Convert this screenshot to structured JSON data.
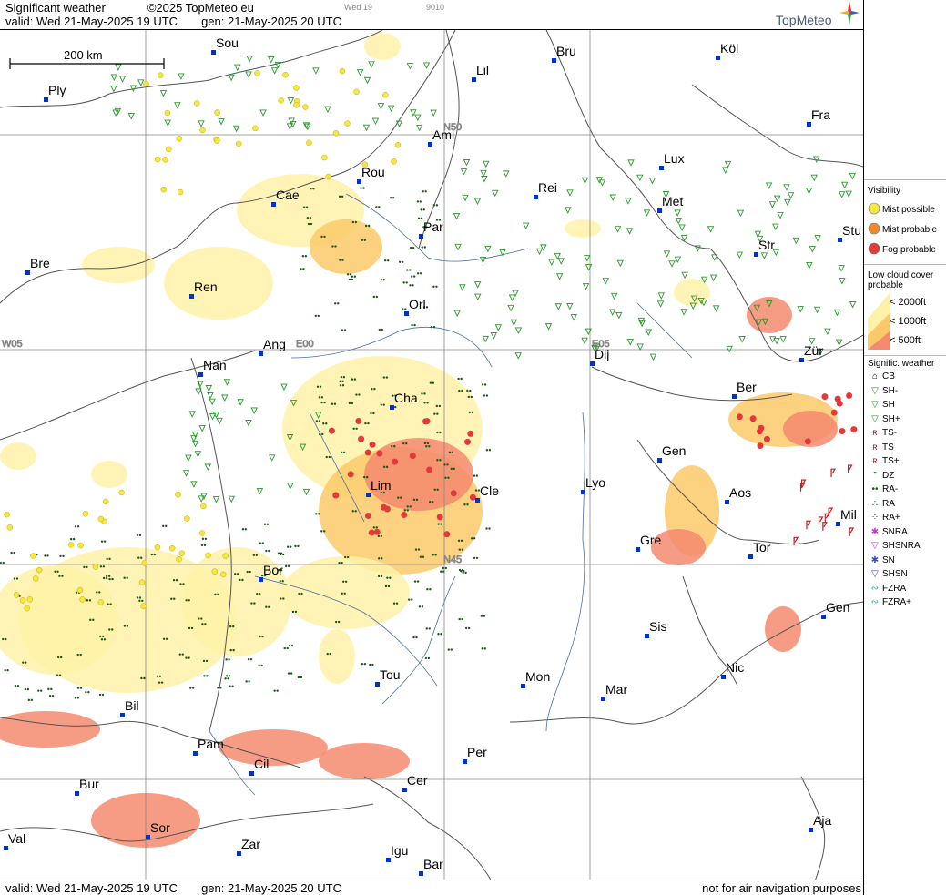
{
  "header": {
    "title": "Significant weather",
    "copyright": "©2025 TopMeteo.eu",
    "small_day": "Wed 19",
    "small_code": "9010",
    "valid": "valid:  Wed  21-May-2025  19 UTC",
    "gen": "gen: 21-May-2025 20 UTC",
    "brand": "TopMeteo"
  },
  "footer": {
    "valid": "valid:  Wed  21-May-2025  19 UTC",
    "gen": "gen: 21-May-2025 20 UTC",
    "note": "not for air navigation purposes"
  },
  "scale_bar": {
    "label": "200 km"
  },
  "grid_labels": [
    "N50",
    "N45",
    "W05",
    "E00",
    "E05"
  ],
  "cities": [
    "Sou",
    "Bru",
    "Köl",
    "Lil",
    "Ply",
    "Ami",
    "Fra",
    "Lux",
    "Rou",
    "Cae",
    "Rei",
    "Met",
    "Bre",
    "Par",
    "Stu",
    "Str",
    "Ren",
    "Orl",
    "Ang",
    "Nan",
    "Dij",
    "Zür",
    "Ber",
    "Cha",
    "Gen",
    "Lim",
    "Cle",
    "Lyo",
    "Aos",
    "Mil",
    "Gre",
    "Tor",
    "Bor",
    "Gen",
    "Sis",
    "Nic",
    "Tou",
    "Mon",
    "Mar",
    "Bil",
    "Pam",
    "Cil",
    "Per",
    "Bur",
    "Cer",
    "Sor",
    "Aja",
    "Val",
    "Zar",
    "Igu",
    "Bar"
  ],
  "legend": {
    "visibility_title": "Visibility",
    "visibility": [
      {
        "label": "Mist possible",
        "color": "#f5e642"
      },
      {
        "label": "Mist probable",
        "color": "#f08a2c"
      },
      {
        "label": "Fog probable",
        "color": "#e23a3a"
      }
    ],
    "cloud_title": [
      "Low cloud cover",
      "probable"
    ],
    "cloud": [
      {
        "label": "< 2000ft",
        "color": "#fff2a8"
      },
      {
        "label": "< 1000ft",
        "color": "#fcc96a"
      },
      {
        "label": "<  500ft",
        "color": "#f48a6e"
      }
    ],
    "weather_title": "Signific. weather",
    "weather": [
      {
        "label": "CB",
        "icon": "cb-icon",
        "glyph": "⌂",
        "color": "#000"
      },
      {
        "label": "SH-",
        "icon": "shower-light-icon",
        "glyph": "▽",
        "color": "#2a9a2a"
      },
      {
        "label": "SH",
        "icon": "shower-icon",
        "glyph": "▽",
        "color": "#2a9a2a"
      },
      {
        "label": "SH+",
        "icon": "shower-heavy-icon",
        "glyph": "▽",
        "color": "#2a9a2a"
      },
      {
        "label": "TS-",
        "icon": "thunderstorm-light-icon",
        "glyph": "ʀ",
        "color": "#b22"
      },
      {
        "label": "TS",
        "icon": "thunderstorm-icon",
        "glyph": "ʀ",
        "color": "#b22"
      },
      {
        "label": "TS+",
        "icon": "thunderstorm-heavy-icon",
        "glyph": "ʀ",
        "color": "#b22"
      },
      {
        "label": "DZ",
        "icon": "drizzle-icon",
        "glyph": "”",
        "color": "#1a5a1a"
      },
      {
        "label": "RA-",
        "icon": "rain-light-icon",
        "glyph": "••",
        "color": "#1a5a1a"
      },
      {
        "label": "RA",
        "icon": "rain-icon",
        "glyph": "∴",
        "color": "#1a5a1a"
      },
      {
        "label": "RA+",
        "icon": "rain-heavy-icon",
        "glyph": "⁘",
        "color": "#1a5a1a"
      },
      {
        "label": "SNRA",
        "icon": "snow-rain-icon",
        "glyph": "✱",
        "color": "#c040c0"
      },
      {
        "label": "SHSNRA",
        "icon": "shower-snow-rain-icon",
        "glyph": "▽",
        "color": "#c040c0"
      },
      {
        "label": "SN",
        "icon": "snow-icon",
        "glyph": "✱",
        "color": "#3050d0"
      },
      {
        "label": "SHSN",
        "icon": "shower-snow-icon",
        "glyph": "▽",
        "color": "#3050d0"
      },
      {
        "label": "FZRA",
        "icon": "freezing-rain-icon",
        "glyph": "∾",
        "color": "#1ab0d0"
      },
      {
        "label": "FZRA+",
        "icon": "freezing-rain-heavy-icon",
        "glyph": "∾",
        "color": "#1ab0d0"
      }
    ]
  }
}
